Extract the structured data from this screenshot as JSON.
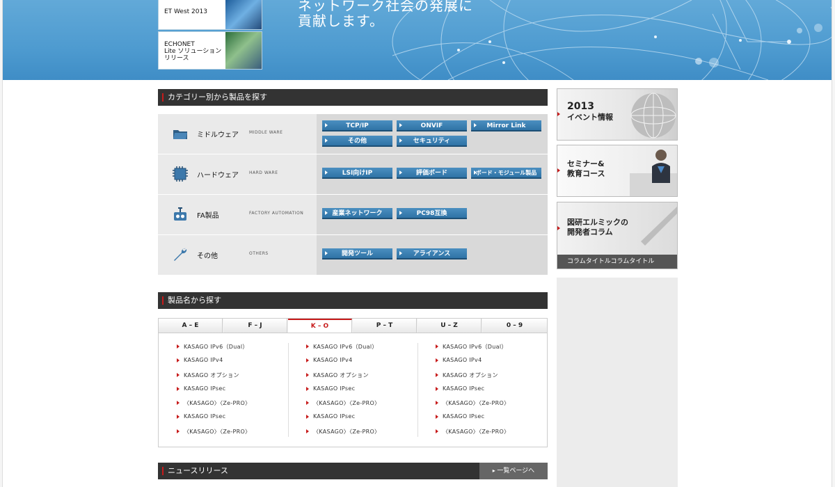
{
  "hero": {
    "tagline_line1": "ネットワーク社会の発展に",
    "tagline_line2": "貢献します。",
    "events": [
      {
        "label": "ET West 2013"
      },
      {
        "label_lines": [
          "ECHONET",
          "Lite ソリューション",
          "リリース"
        ]
      }
    ]
  },
  "category_section": {
    "title": "カテゴリー別から製品を探す",
    "rows": [
      {
        "label": "ミドルウェア",
        "en": "MIDDLE WARE",
        "icon": "folder-icon",
        "buttons": [
          "TCP/IP",
          "ONVIF",
          "Mirror Link",
          "その他",
          "セキュリティ"
        ]
      },
      {
        "label": "ハードウェア",
        "en": "HARD WARE",
        "icon": "chip-icon",
        "buttons": [
          "LSI向けIP",
          "評価ボード",
          "ボード・モジュール製品"
        ]
      },
      {
        "label": "FA製品",
        "en": "FACTORY AUTOMATION",
        "icon": "robot-icon",
        "buttons": [
          "産業ネットワーク",
          "PC98互換"
        ]
      },
      {
        "label": "その他",
        "en": "OTHERS",
        "icon": "wrench-icon",
        "buttons": [
          "開発ツール",
          "アライアンス"
        ]
      }
    ]
  },
  "product_name_section": {
    "title": "製品名から探す",
    "tabs": [
      "A – E",
      "F – J",
      "K – O",
      "P – T",
      "U – Z",
      "0 – 9"
    ],
    "active_tab": "K – O",
    "columns": [
      [
        "KASAGO IPv6（Dual）",
        "KASAGO IPv4",
        "KASAGO オプション",
        "KASAGO IPsec",
        "〈KASAGO〉〈Ze-PRO〉",
        "KASAGO IPsec",
        "〈KASAGO〉〈Ze-PRO〉"
      ],
      [
        "KASAGO IPv6（Dual）",
        "KASAGO IPv4",
        "KASAGO オプション",
        "KASAGO IPsec",
        "〈KASAGO〉〈Ze-PRO〉",
        "KASAGO IPsec",
        "〈KASAGO〉〈Ze-PRO〉"
      ],
      [
        "KASAGO IPv6（Dual）",
        "KASAGO IPv4",
        "KASAGO オプション",
        "KASAGO IPsec",
        "〈KASAGO〉〈Ze-PRO〉",
        "KASAGO IPsec",
        "〈KASAGO〉〈Ze-PRO〉"
      ]
    ]
  },
  "news_section": {
    "title": "ニュースリリース",
    "more_label": "一覧ページへ"
  },
  "sidebar": {
    "event_box": {
      "title_lines": [
        "2013",
        "イベント情報"
      ]
    },
    "seminar_box": {
      "title_lines": [
        "セミナー&",
        "教育コース"
      ]
    },
    "column_box": {
      "title_lines": [
        "図研エルミックの",
        "開発者コラム"
      ],
      "caption": "コラムタイトルコラムタイトル"
    }
  },
  "colors": {
    "accent_red": "#c71b1b",
    "button_blue": "#2f73a6",
    "header_dark": "#333333",
    "hero_blue": "#4e9bd0"
  }
}
